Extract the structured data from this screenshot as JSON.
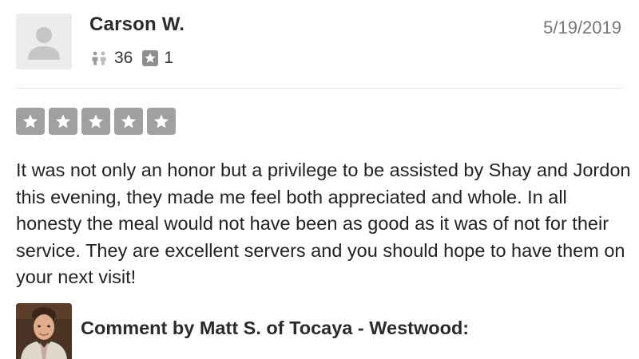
{
  "review": {
    "author": {
      "name": "Carson W.",
      "avatar": "default-user-silhouette-icon",
      "friends_count": "36",
      "friends_icon": "friends-icon",
      "reviews_count": "1",
      "reviews_icon": "star-square-icon"
    },
    "date": "5/19/2019",
    "rating": {
      "value": 5,
      "max": 5,
      "star_box_color": "#a0a0a0"
    },
    "text": "It was not only an honor but a privilege to be assisted by Shay and Jordon this evening, they made me feel both appreciated and whole. In all honesty the meal would not have been as good as it was of not for their service. They are excellent servers and you should hope to have them on your next visit!"
  },
  "owner_comment": {
    "heading": "Comment by Matt S. of Tocaya - Westwood:",
    "avatar": "owner-photo"
  }
}
